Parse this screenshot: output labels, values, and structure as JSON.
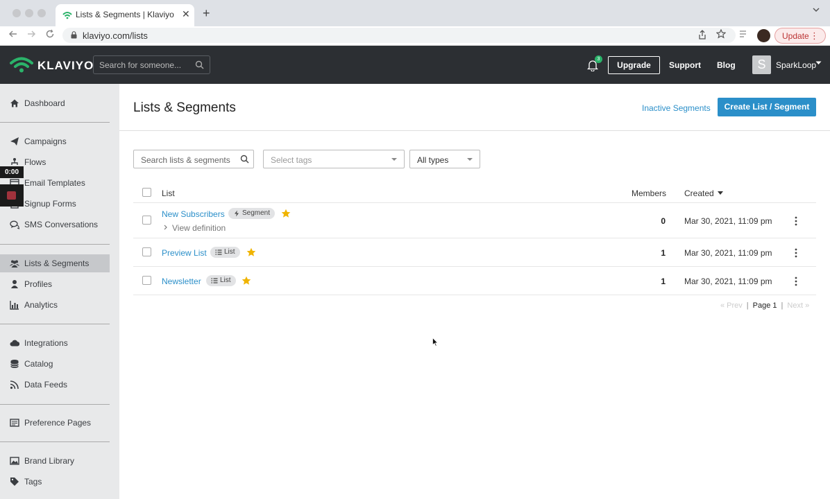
{
  "browser": {
    "tab_title": "Lists & Segments | Klaviyo",
    "tab_close": "✕",
    "new_tab": "+",
    "url": "klaviyo.com/lists",
    "update_label": "Update"
  },
  "header": {
    "logo_text": "KLAVIYO",
    "search_placeholder": "Search for someone...",
    "notification_count": "3",
    "upgrade_label": "Upgrade",
    "support_label": "Support",
    "blog_label": "Blog",
    "account_initial": "S",
    "account_name": "SparkLoop"
  },
  "sidebar": {
    "items": [
      {
        "label": "Dashboard",
        "icon": "home-icon"
      },
      {
        "label": "Campaigns",
        "icon": "paper-plane-icon"
      },
      {
        "label": "Flows",
        "icon": "flow-icon"
      },
      {
        "label": "Email Templates",
        "icon": "template-icon"
      },
      {
        "label": "Signup Forms",
        "icon": "form-icon"
      },
      {
        "label": "SMS Conversations",
        "icon": "chat-icon"
      },
      {
        "label": "Lists & Segments",
        "icon": "users-icon",
        "active": true
      },
      {
        "label": "Profiles",
        "icon": "user-icon"
      },
      {
        "label": "Analytics",
        "icon": "bar-chart-icon"
      },
      {
        "label": "Integrations",
        "icon": "cloud-icon"
      },
      {
        "label": "Catalog",
        "icon": "database-icon"
      },
      {
        "label": "Data Feeds",
        "icon": "rss-icon"
      },
      {
        "label": "Preference Pages",
        "icon": "page-icon"
      },
      {
        "label": "Brand Library",
        "icon": "image-icon"
      },
      {
        "label": "Tags",
        "icon": "tag-icon"
      }
    ],
    "recorder_time": "0:00"
  },
  "main": {
    "title": "Lists & Segments",
    "inactive_segments_label": "Inactive Segments",
    "create_label": "Create List / Segment",
    "filters": {
      "search_placeholder": "Search lists & segments",
      "tags_placeholder": "Select tags",
      "types_value": "All types"
    },
    "table": {
      "headers": {
        "list": "List",
        "members": "Members",
        "created": "Created"
      },
      "rows": [
        {
          "name": "New Subscribers",
          "type": "Segment",
          "starred": true,
          "members": "0",
          "created": "Mar 30, 2021, 11:09 pm",
          "view_definition": "View definition"
        },
        {
          "name": "Preview List",
          "type": "List",
          "starred": true,
          "members": "1",
          "created": "Mar 30, 2021, 11:09 pm"
        },
        {
          "name": "Newsletter",
          "type": "List",
          "starred": true,
          "members": "1",
          "created": "Mar 30, 2021, 11:09 pm"
        }
      ]
    },
    "pagination": {
      "prev": "« Prev",
      "page": "Page 1",
      "next": "Next »"
    }
  },
  "colors": {
    "accent": "#2b8fc9",
    "header_bg": "#2c2f33",
    "star": "#f0b400",
    "logo_green": "#2bb36a"
  }
}
